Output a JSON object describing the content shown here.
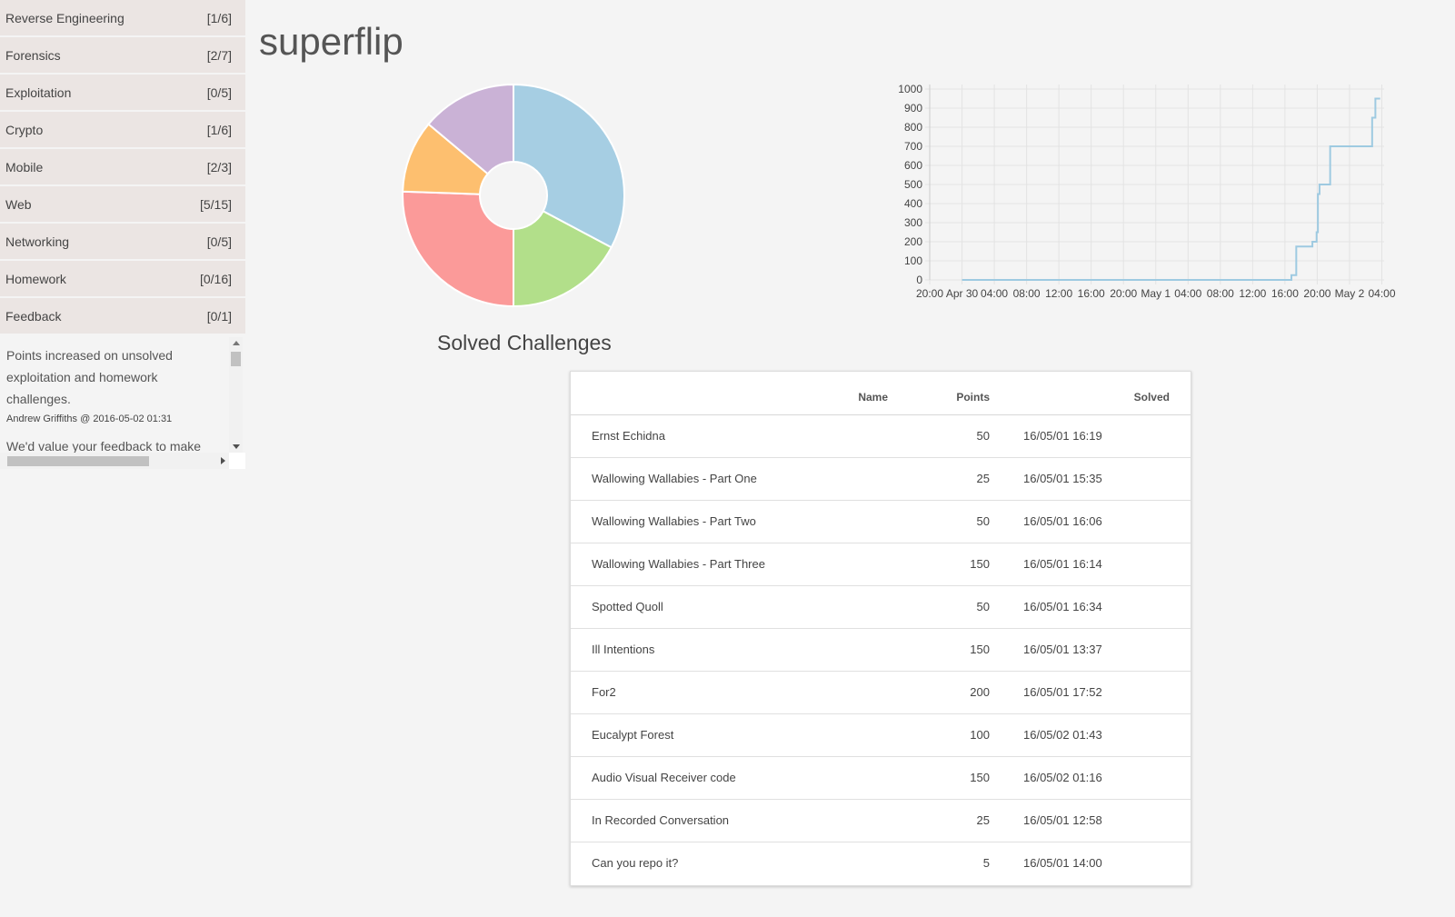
{
  "sidebar": {
    "categories": [
      {
        "label": "Reverse Engineering",
        "count": "[1/6]"
      },
      {
        "label": "Forensics",
        "count": "[2/7]"
      },
      {
        "label": "Exploitation",
        "count": "[0/5]"
      },
      {
        "label": "Crypto",
        "count": "[1/6]"
      },
      {
        "label": "Mobile",
        "count": "[2/3]"
      },
      {
        "label": "Web",
        "count": "[5/15]"
      },
      {
        "label": "Networking",
        "count": "[0/5]"
      },
      {
        "label": "Homework",
        "count": "[0/16]"
      },
      {
        "label": "Feedback",
        "count": "[0/1]"
      }
    ],
    "news": {
      "text": "Points increased on unsolved exploitation and homework challenges.",
      "meta": "Andrew Griffiths @ 2016-05-02 01:31",
      "next_text": "We'd value your feedback to make"
    }
  },
  "team": {
    "name": "superflip"
  },
  "pie": {
    "title": "Solved Challenges",
    "colors": [
      "#a6cee3",
      "#b2df8a",
      "#fb9a99",
      "#fdbf6f",
      "#cab2d6"
    ]
  },
  "chart_data": {
    "type": "line",
    "x_ticks": [
      "20:00",
      "Apr 30",
      "04:00",
      "08:00",
      "12:00",
      "16:00",
      "20:00",
      "May 1",
      "04:00",
      "08:00",
      "12:00",
      "16:00",
      "20:00",
      "May 2",
      "04:00"
    ],
    "y_ticks": [
      0,
      100,
      200,
      300,
      400,
      500,
      600,
      700,
      800,
      900,
      1000
    ],
    "ylim": [
      0,
      1000
    ],
    "color": "#9ecae1",
    "points": [
      {
        "x": 1,
        "y": 0
      },
      {
        "x": 11.2,
        "y": 0
      },
      {
        "x": 11.2,
        "y": 25
      },
      {
        "x": 11.35,
        "y": 25
      },
      {
        "x": 11.35,
        "y": 175
      },
      {
        "x": 11.85,
        "y": 175
      },
      {
        "x": 11.85,
        "y": 200
      },
      {
        "x": 11.98,
        "y": 200
      },
      {
        "x": 11.98,
        "y": 250
      },
      {
        "x": 12.02,
        "y": 250
      },
      {
        "x": 12.02,
        "y": 450
      },
      {
        "x": 12.07,
        "y": 450
      },
      {
        "x": 12.07,
        "y": 500
      },
      {
        "x": 12.4,
        "y": 500
      },
      {
        "x": 12.4,
        "y": 700
      },
      {
        "x": 13.7,
        "y": 700
      },
      {
        "x": 13.7,
        "y": 850
      },
      {
        "x": 13.8,
        "y": 850
      },
      {
        "x": 13.8,
        "y": 950
      },
      {
        "x": 13.95,
        "y": 950
      }
    ]
  },
  "table": {
    "headers": {
      "name": "Name",
      "points": "Points",
      "solved": "Solved"
    },
    "rows": [
      {
        "name": "Ernst Echidna",
        "points": "50",
        "solved": "16/05/01 16:19"
      },
      {
        "name": "Wallowing Wallabies - Part One",
        "points": "25",
        "solved": "16/05/01 15:35"
      },
      {
        "name": "Wallowing Wallabies - Part Two",
        "points": "50",
        "solved": "16/05/01 16:06"
      },
      {
        "name": "Wallowing Wallabies - Part Three",
        "points": "150",
        "solved": "16/05/01 16:14"
      },
      {
        "name": "Spotted Quoll",
        "points": "50",
        "solved": "16/05/01 16:34"
      },
      {
        "name": "Ill Intentions",
        "points": "150",
        "solved": "16/05/01 13:37"
      },
      {
        "name": "For2",
        "points": "200",
        "solved": "16/05/01 17:52"
      },
      {
        "name": "Eucalypt Forest",
        "points": "100",
        "solved": "16/05/02 01:43"
      },
      {
        "name": "Audio Visual Receiver code",
        "points": "150",
        "solved": "16/05/02 01:16"
      },
      {
        "name": "In Recorded Conversation",
        "points": "25",
        "solved": "16/05/01 12:58"
      },
      {
        "name": "Can you repo it?",
        "points": "5",
        "solved": "16/05/01 14:00"
      }
    ]
  }
}
